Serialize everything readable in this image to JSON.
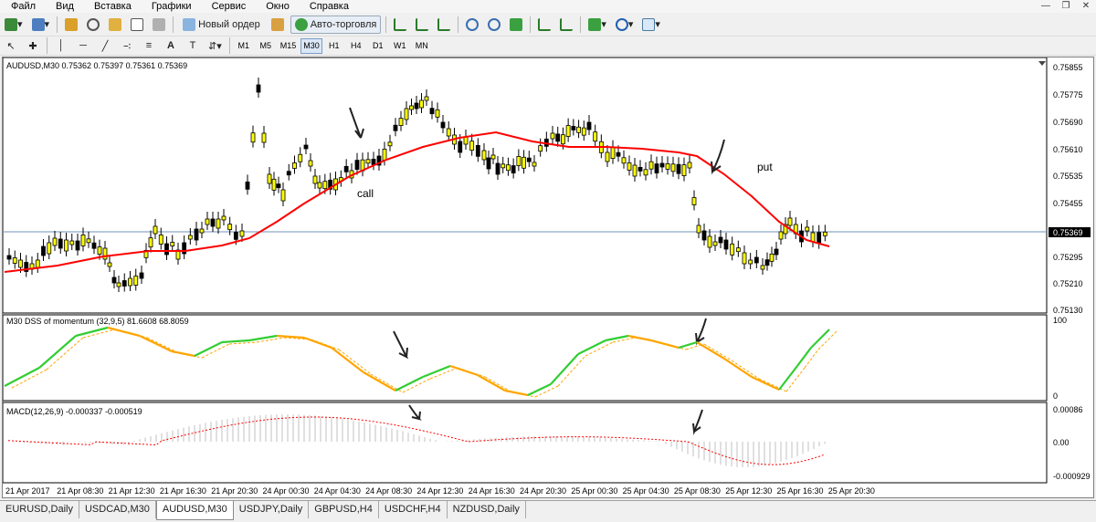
{
  "menu": [
    "Файл",
    "Вид",
    "Вставка",
    "Графики",
    "Сервис",
    "Окно",
    "Справка"
  ],
  "toolbar": {
    "new_order": "Новый ордер",
    "autotrading": "Авто-торговля"
  },
  "timeframes": [
    "M1",
    "M5",
    "M15",
    "M30",
    "H1",
    "H4",
    "D1",
    "W1",
    "MN"
  ],
  "active_timeframe": "M30",
  "main_chart": {
    "header": "AUDUSD,M30  0.75362 0.75397 0.75361 0.75369",
    "price_labels": [
      "0.75855",
      "0.75775",
      "0.75690",
      "0.75610",
      "0.75535",
      "0.75455",
      "0.75369",
      "0.75295",
      "0.75210",
      "0.75130"
    ],
    "current_price": "0.75369",
    "annotation_call": "call",
    "annotation_put": "put"
  },
  "dss_panel": {
    "header": "M30 DSS of momentum (32,9,5) 81.6608 68.8059",
    "scale": [
      "100",
      "0"
    ]
  },
  "macd_panel": {
    "header": "MACD(12,26,9) -0.000337 -0.000519",
    "scale": [
      "0.00086",
      "0.00",
      "-0.000929"
    ]
  },
  "time_axis": [
    "21 Apr 2017",
    "21 Apr 08:30",
    "21 Apr 12:30",
    "21 Apr 16:30",
    "21 Apr 20:30",
    "24 Apr 00:30",
    "24 Apr 04:30",
    "24 Apr 08:30",
    "24 Apr 12:30",
    "24 Apr 16:30",
    "24 Apr 20:30",
    "25 Apr 00:30",
    "25 Apr 04:30",
    "25 Apr 08:30",
    "25 Apr 12:30",
    "25 Apr 16:30",
    "25 Apr 20:30"
  ],
  "symbol_tabs": [
    "EURUSD,Daily",
    "USDCAD,M30",
    "AUDUSD,M30",
    "USDJPY,Daily",
    "GBPUSD,H4",
    "USDCHF,H4",
    "NZDUSD,Daily"
  ],
  "active_tab": "AUDUSD,M30",
  "colors": {
    "bull_candle": "#ffff00",
    "ma_line": "#ff0000",
    "dss_up": "#32cd32",
    "dss_down": "#ffa500",
    "macd_hist": "#c0c0c0",
    "macd_signal": "#ff0000"
  }
}
